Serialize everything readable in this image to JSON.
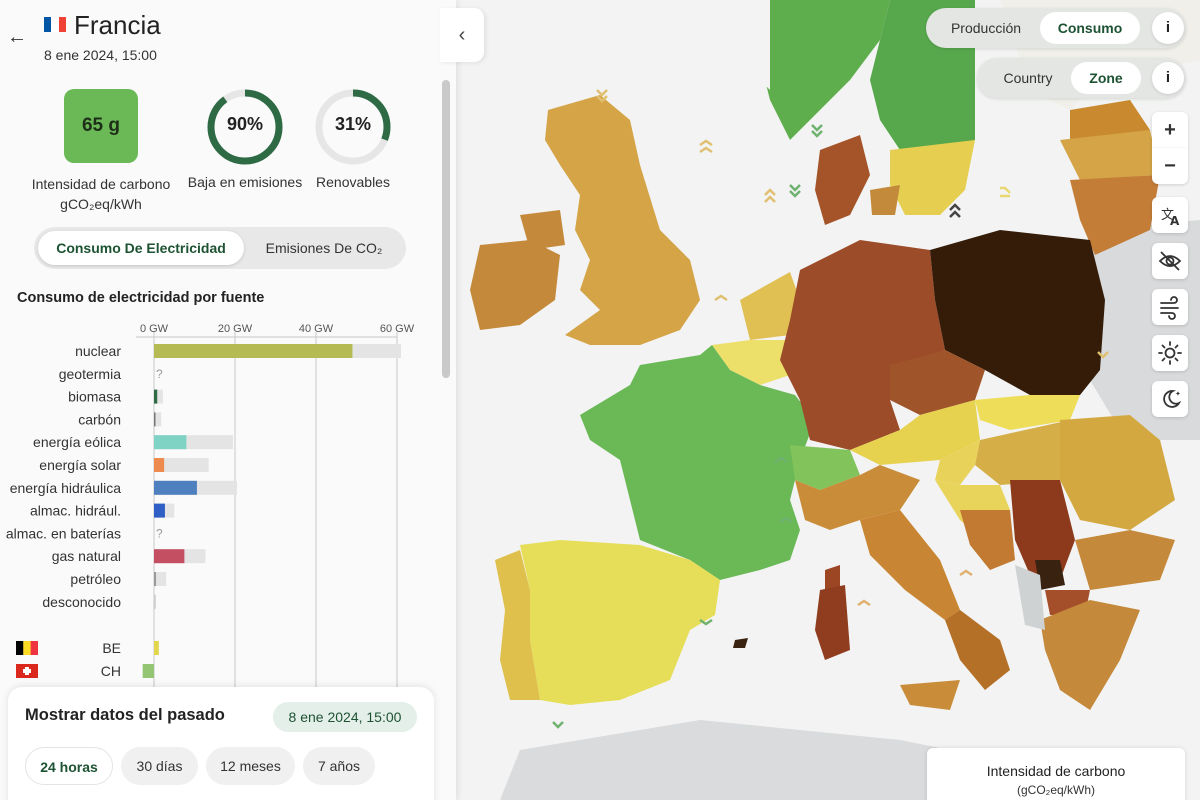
{
  "zone": {
    "name": "Francia",
    "datetime": "8 ene 2024, 15:00",
    "flag_colors": [
      "#0055a4",
      "#ffffff",
      "#ef4135"
    ]
  },
  "stats": {
    "carbon_intensity": {
      "value": "65 g",
      "label_line1": "Intensidad de carbono",
      "label_line2": "gCO₂eq/kWh",
      "color": "#6ab856"
    },
    "low_emissions": {
      "value": "90%",
      "fraction": 0.9,
      "label": "Baja en emisiones"
    },
    "renewables": {
      "value": "31%",
      "fraction": 0.31,
      "label": "Renovables"
    }
  },
  "data_toggle": {
    "options": [
      "Consumo De Electricidad",
      "Emisiones De CO₂"
    ],
    "selected": "Consumo De Electricidad"
  },
  "source_chart": {
    "title": "Consumo de electricidad por fuente"
  },
  "chart_data": {
    "type": "bar",
    "orientation": "horizontal",
    "xlim": [
      0,
      60
    ],
    "ticks": [
      {
        "value": 0,
        "label": "0 GW"
      },
      {
        "value": 20,
        "label": "20 GW"
      },
      {
        "value": 40,
        "label": "40 GW"
      },
      {
        "value": 60,
        "label": "60 GW"
      }
    ],
    "unit": "GW",
    "categories": [
      "nuclear",
      "geotermia",
      "biomasa",
      "carbón",
      "energía eólica",
      "energía solar",
      "energía hidráulica",
      "almac. hidrául.",
      "almac. en baterías",
      "gas natural",
      "petróleo",
      "desconocido"
    ],
    "series": [
      {
        "values": [
          49,
          null,
          0.8,
          0.1,
          8,
          2.5,
          10.6,
          2.7,
          null,
          7.5,
          0.5,
          0.1
        ],
        "colors": [
          "#b5bb52",
          "",
          "#2e6b45",
          "#777777",
          "#7fd3c5",
          "#ef8a4f",
          "#4e7fbf",
          "#2f5fc4",
          "",
          "#c44f63",
          "#999999",
          "#cccccc"
        ]
      },
      {
        "values": [
          61,
          null,
          2.2,
          1.8,
          19.5,
          13.5,
          20.5,
          5,
          null,
          12.7,
          3,
          0.5
        ]
      }
    ],
    "missing_marker": "?",
    "exchanges": [
      {
        "label": "BE",
        "value": 1.2,
        "color": "#e4d54e",
        "flag": [
          "#000000",
          "#fdda24",
          "#ef3340"
        ]
      },
      {
        "label": "CH",
        "value": -2.8,
        "color": "#93c573",
        "flag": [
          "#da291c",
          "#ffffff"
        ]
      }
    ]
  },
  "past_data": {
    "title": "Mostrar datos del pasado",
    "datetime": "8 ene 2024, 15:00",
    "ranges": [
      "24 horas",
      "30 días",
      "12 meses",
      "7 años"
    ],
    "selected": "24 horas"
  },
  "map_controls": {
    "mode": {
      "options": [
        "Producción",
        "Consumo"
      ],
      "selected": "Consumo",
      "info": "i"
    },
    "granularity": {
      "options": [
        "Country",
        "Zone"
      ],
      "selected": "Zone",
      "info": "i"
    },
    "zoom_in": "+",
    "zoom_out": "−"
  },
  "map_legend": {
    "title": "Intensidad de carbono",
    "unit": "(gCO₂eq/kWh)"
  }
}
